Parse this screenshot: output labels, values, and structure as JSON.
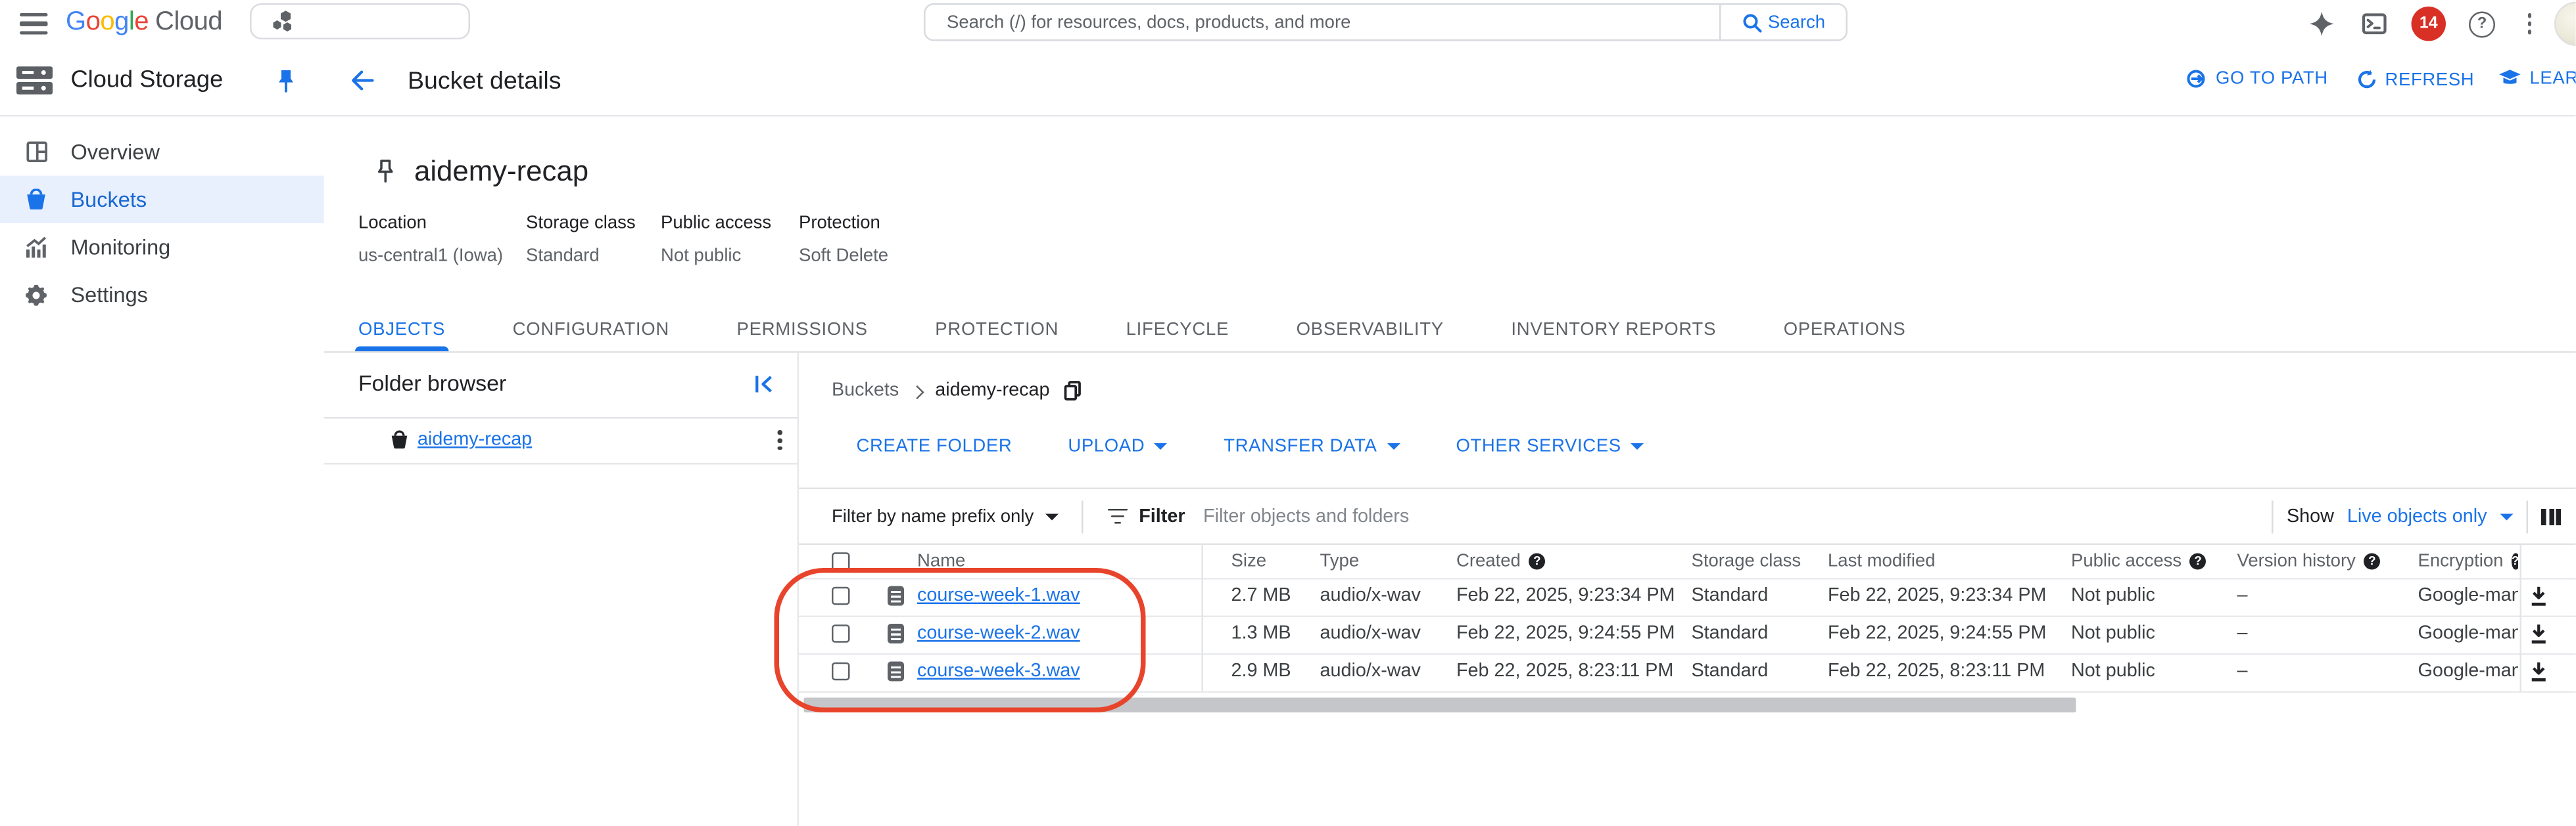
{
  "topbar": {
    "logo_letters": [
      "G",
      "o",
      "o",
      "g",
      "l",
      "e"
    ],
    "logo_cloud": "Cloud",
    "search_placeholder": "Search (/) for resources, docs, products, and more",
    "search_button": "Search",
    "notification_count": "14"
  },
  "sidebar": {
    "product": "Cloud Storage",
    "items": [
      {
        "label": "Overview"
      },
      {
        "label": "Buckets"
      },
      {
        "label": "Monitoring"
      },
      {
        "label": "Settings"
      }
    ]
  },
  "page": {
    "title": "Bucket details",
    "actions": {
      "go_to_path": "GO TO PATH",
      "refresh": "REFRESH",
      "learn": "LEARN"
    }
  },
  "bucket": {
    "name": "aidemy-recap",
    "meta": [
      {
        "label": "Location",
        "value": "us-central1 (Iowa)"
      },
      {
        "label": "Storage class",
        "value": "Standard"
      },
      {
        "label": "Public access",
        "value": "Not public"
      },
      {
        "label": "Protection",
        "value": "Soft Delete"
      }
    ]
  },
  "tabs": {
    "items": [
      "OBJECTS",
      "CONFIGURATION",
      "PERMISSIONS",
      "PROTECTION",
      "LIFECYCLE",
      "OBSERVABILITY",
      "INVENTORY REPORTS",
      "OPERATIONS"
    ]
  },
  "folder_browser": {
    "title": "Folder browser",
    "bucket_link": "aidemy-recap"
  },
  "objects": {
    "breadcrumb": {
      "root": "Buckets",
      "current": "aidemy-recap"
    },
    "actions": {
      "create_folder": "CREATE FOLDER",
      "upload": "UPLOAD",
      "transfer_data": "TRANSFER DATA",
      "other_services": "OTHER SERVICES"
    },
    "filter": {
      "prefix": "Filter by name prefix only",
      "label": "Filter",
      "placeholder": "Filter objects and folders",
      "show": "Show",
      "show_value": "Live objects only"
    },
    "columns": {
      "name": "Name",
      "size": "Size",
      "type": "Type",
      "created": "Created",
      "storage_class": "Storage class",
      "last_modified": "Last modified",
      "public_access": "Public access",
      "version_history": "Version history",
      "encryption": "Encryption"
    },
    "rows": [
      {
        "name": "course-week-1.wav",
        "size": "2.7 MB",
        "type": "audio/x-wav",
        "created": "Feb 22, 2025, 9:23:34 PM",
        "storage_class": "Standard",
        "last_modified": "Feb 22, 2025, 9:23:34 PM",
        "public_access": "Not public",
        "version_history": "–",
        "encryption": "Google-mana"
      },
      {
        "name": "course-week-2.wav",
        "size": "1.3 MB",
        "type": "audio/x-wav",
        "created": "Feb 22, 2025, 9:24:55 PM",
        "storage_class": "Standard",
        "last_modified": "Feb 22, 2025, 9:24:55 PM",
        "public_access": "Not public",
        "version_history": "–",
        "encryption": "Google-mana"
      },
      {
        "name": "course-week-3.wav",
        "size": "2.9 MB",
        "type": "audio/x-wav",
        "created": "Feb 22, 2025, 8:23:11 PM",
        "storage_class": "Standard",
        "last_modified": "Feb 22, 2025, 8:23:11 PM",
        "public_access": "Not public",
        "version_history": "–",
        "encryption": "Google-mana"
      }
    ]
  },
  "colors": {
    "accent": "#1a73e8",
    "badge": "#d93025",
    "annotation": "#e8442c"
  }
}
